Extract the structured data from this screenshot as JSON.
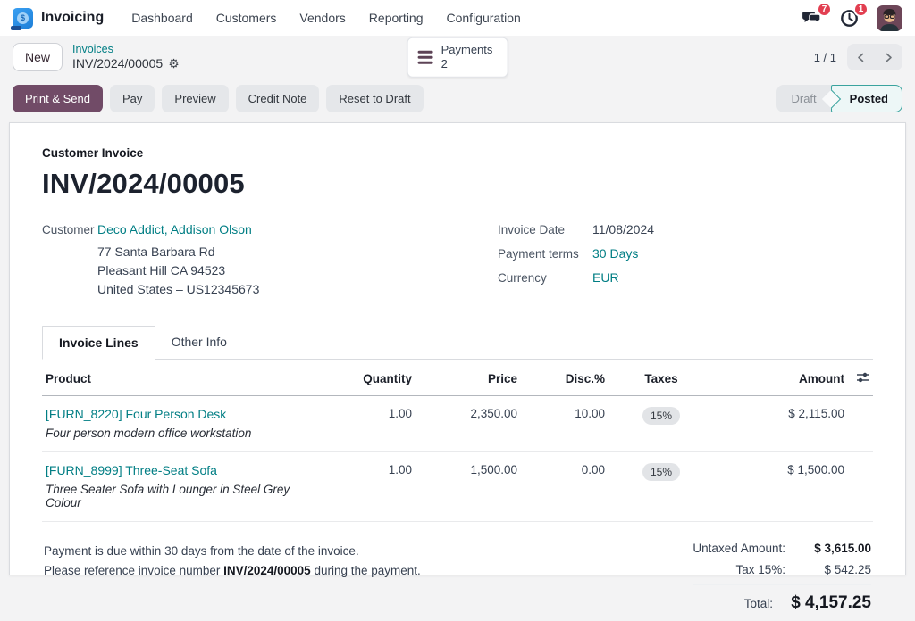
{
  "nav": {
    "app_name": "Invoicing",
    "items": [
      "Dashboard",
      "Customers",
      "Vendors",
      "Reporting",
      "Configuration"
    ],
    "messages_badge": "7",
    "activities_badge": "1"
  },
  "control_panel": {
    "new_button": "New",
    "breadcrumb_parent": "Invoices",
    "breadcrumb_current": "INV/2024/00005",
    "payments_button": {
      "label": "Payments",
      "count": "2"
    },
    "pager_count": "1 / 1"
  },
  "actions": {
    "print_send": "Print & Send",
    "pay": "Pay",
    "preview": "Preview",
    "credit_note": "Credit Note",
    "reset_to_draft": "Reset to Draft",
    "status_draft": "Draft",
    "status_posted": "Posted"
  },
  "invoice": {
    "type_label": "Customer Invoice",
    "number": "INV/2024/00005",
    "customer_label": "Customer",
    "customer_name": "Deco Addict, Addison Olson",
    "address_line1": "77 Santa Barbara Rd",
    "address_line2": "Pleasant Hill CA 94523",
    "address_line3": "United States – US12345673",
    "date_label": "Invoice Date",
    "date_value": "11/08/2024",
    "terms_label": "Payment terms",
    "terms_value": "30 Days",
    "currency_label": "Currency",
    "currency_value": "EUR"
  },
  "tabs": {
    "lines": "Invoice Lines",
    "other": "Other Info"
  },
  "lines_table": {
    "columns": {
      "product": "Product",
      "quantity": "Quantity",
      "price": "Price",
      "discount": "Disc.%",
      "taxes": "Taxes",
      "amount": "Amount"
    },
    "rows": [
      {
        "product": "[FURN_8220] Four Person Desk",
        "description": "Four person modern office workstation",
        "quantity": "1.00",
        "price": "2,350.00",
        "discount": "10.00",
        "tax": "15%",
        "amount": "$ 2,115.00"
      },
      {
        "product": "[FURN_8999] Three-Seat Sofa",
        "description": "Three Seater Sofa with Lounger in Steel Grey Colour",
        "quantity": "1.00",
        "price": "1,500.00",
        "discount": "0.00",
        "tax": "15%",
        "amount": "$ 1,500.00"
      }
    ]
  },
  "footer": {
    "note_line1": "Payment is due within 30 days from the date of the invoice.",
    "note_line2_prefix": "Please reference invoice number ",
    "note_line2_bold": "INV/2024/00005",
    "note_line2_suffix": " during the payment.",
    "untaxed_label": "Untaxed Amount:",
    "untaxed_value": "$ 3,615.00",
    "tax_label": "Tax 15%:",
    "tax_value": "$ 542.25",
    "total_label": "Total:",
    "total_value": "$ 4,157.25"
  },
  "icons": {
    "logo": "invoicing-app-logo",
    "messages": "chat-bubbles",
    "activities": "clock",
    "gear": "settings-gear",
    "payments": "hamburger-lines",
    "pager_prev": "chevron-left",
    "pager_next": "chevron-right",
    "columns": "sliders"
  },
  "colors": {
    "primary": "#714B67",
    "link": "#017E84",
    "posted_border": "#3AA39E",
    "badge_red": "#E23F51"
  }
}
